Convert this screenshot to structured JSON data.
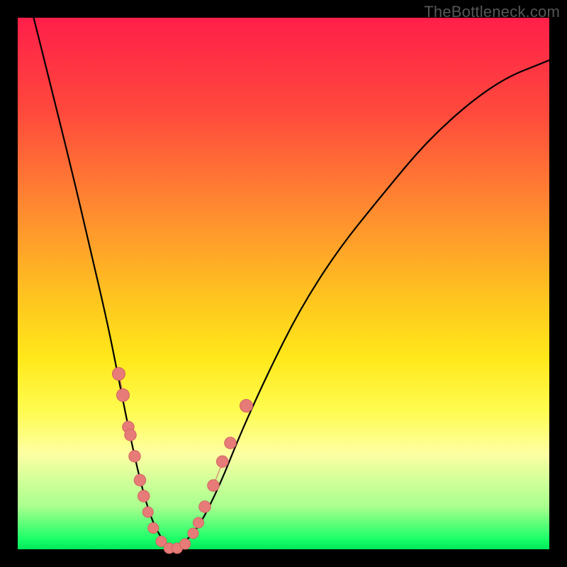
{
  "watermark": "TheBottleneck.com",
  "chart_data": {
    "type": "line",
    "title": "",
    "xlabel": "",
    "ylabel": "",
    "xlim": [
      0,
      100
    ],
    "ylim": [
      0,
      100
    ],
    "grid": false,
    "legend": false,
    "series": [
      {
        "name": "bottleneck-curve",
        "x": [
          3,
          6,
          10,
          14,
          17,
          19,
          21,
          23,
          25,
          27,
          29,
          31,
          34,
          38,
          42,
          47,
          53,
          60,
          68,
          78,
          90,
          100
        ],
        "y": [
          100,
          88,
          72,
          55,
          42,
          32,
          22,
          13,
          6,
          2,
          0,
          1,
          4,
          12,
          22,
          33,
          45,
          56,
          66,
          78,
          88,
          92
        ]
      }
    ],
    "markers": {
      "name": "highlighted-points",
      "points": [
        {
          "x": 19.0,
          "y": 33,
          "r": 1.2
        },
        {
          "x": 19.8,
          "y": 29,
          "r": 1.2
        },
        {
          "x": 20.8,
          "y": 23,
          "r": 1.1
        },
        {
          "x": 21.2,
          "y": 21.5,
          "r": 1.1
        },
        {
          "x": 22.0,
          "y": 17.5,
          "r": 1.1
        },
        {
          "x": 23.0,
          "y": 13,
          "r": 1.1
        },
        {
          "x": 23.7,
          "y": 10,
          "r": 1.1
        },
        {
          "x": 24.5,
          "y": 7,
          "r": 1.0
        },
        {
          "x": 25.5,
          "y": 4,
          "r": 1.0
        },
        {
          "x": 27.0,
          "y": 1.5,
          "r": 1.0
        },
        {
          "x": 28.5,
          "y": 0.2,
          "r": 1.0
        },
        {
          "x": 30.0,
          "y": 0.2,
          "r": 1.0
        },
        {
          "x": 31.5,
          "y": 1.0,
          "r": 1.0
        },
        {
          "x": 33.0,
          "y": 3.0,
          "r": 1.0
        },
        {
          "x": 34.0,
          "y": 5.0,
          "r": 1.0
        },
        {
          "x": 35.2,
          "y": 8.0,
          "r": 1.1
        },
        {
          "x": 36.8,
          "y": 12.0,
          "r": 1.1
        },
        {
          "x": 38.5,
          "y": 16.5,
          "r": 1.1
        },
        {
          "x": 40.0,
          "y": 20.0,
          "r": 1.1
        },
        {
          "x": 43.0,
          "y": 27.0,
          "r": 1.2
        }
      ],
      "pills": [
        {
          "x1": 19.0,
          "y1": 33.5,
          "x2": 20.0,
          "y2": 28.0
        },
        {
          "x1": 27.5,
          "y1": 1.0,
          "x2": 31.0,
          "y2": 0.5
        },
        {
          "x1": 37.0,
          "y1": 12.5,
          "x2": 39.0,
          "y2": 17.5
        }
      ]
    },
    "background_gradient": {
      "top": "#ff1f4a",
      "middle": "#ffe81a",
      "bottom": "#00e85c"
    }
  }
}
